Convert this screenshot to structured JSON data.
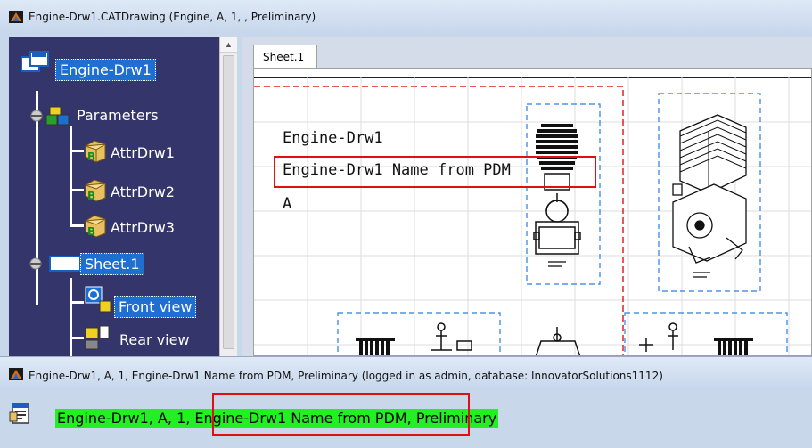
{
  "top_window": {
    "title": "Engine-Drw1.CATDrawing (Engine, A, 1, , Preliminary)"
  },
  "tree": {
    "root": "Engine-Drw1",
    "parameters": "Parameters",
    "attrs": [
      "AttrDrw1",
      "AttrDrw2",
      "AttrDrw3"
    ],
    "sheet": "Sheet.1",
    "views": [
      "Front view",
      "Rear view"
    ]
  },
  "drawing": {
    "tab": "Sheet.1",
    "text_lines": [
      "Engine-Drw1",
      "Engine-Drw1 Name from PDM",
      "A"
    ]
  },
  "bottom_window": {
    "title": "Engine-Drw1, A, 1, Engine-Drw1 Name from PDM, Preliminary (logged in as admin, database: InnovatorSolutions1112)",
    "field_value": "Engine-Drw1, A, 1, Engine-Drw1 Name from PDM, Preliminary"
  },
  "colors": {
    "tree_bg": "#34356a",
    "selection": "#1f6fd1",
    "highlight": "#e01010",
    "field_green": "#22f022",
    "frame_dash_red": "#e02020",
    "view_dash_blue": "#2a7fe0"
  },
  "icons": [
    "catia-window-icon",
    "product-icon",
    "parameters-icon",
    "attribute-icon",
    "sheet-icon",
    "front-view-icon",
    "rear-view-icon",
    "app-document-icon"
  ]
}
